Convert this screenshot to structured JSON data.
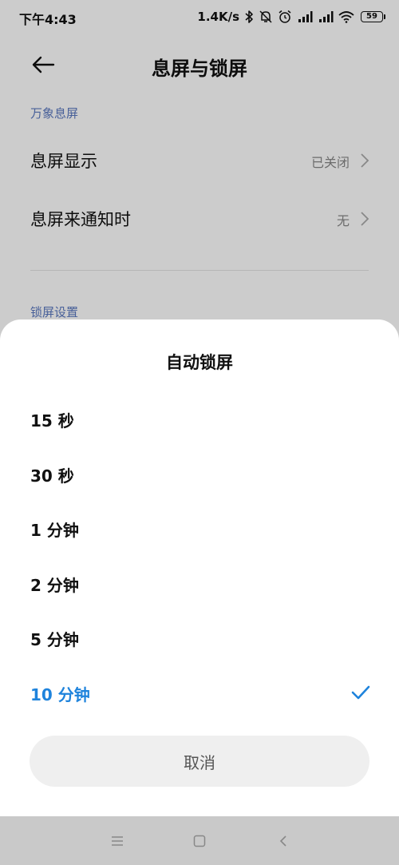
{
  "status_bar": {
    "time": "下午4:43",
    "net_speed": "1.4K/s",
    "battery": "59"
  },
  "header": {
    "title": "息屏与锁屏"
  },
  "sections": {
    "aod_label": "万象息屏",
    "lock_label": "锁屏设置"
  },
  "rows": [
    {
      "title": "息屏显示",
      "value": "已关闭"
    },
    {
      "title": "息屏来通知时",
      "value": "无"
    }
  ],
  "sheet": {
    "title": "自动锁屏",
    "options": [
      {
        "label": "15 秒"
      },
      {
        "label": "30 秒"
      },
      {
        "label": "1 分钟"
      },
      {
        "label": "2 分钟"
      },
      {
        "label": "5 分钟"
      },
      {
        "label": "10 分钟",
        "selected": true
      }
    ],
    "cancel_label": "取消"
  },
  "colors": {
    "accent": "#1e83dc",
    "section_label": "#5a78c0",
    "dim_overlay": "rgba(0,0,0,0.2)",
    "nav_bar": "#c9c9c9"
  },
  "icons": {
    "back": "arrow-left-icon",
    "chevron": "chevron-right-icon",
    "check": "check-icon",
    "nav_menu": "menu-icon",
    "nav_home": "square-home-icon",
    "nav_back": "chevron-left-icon"
  }
}
